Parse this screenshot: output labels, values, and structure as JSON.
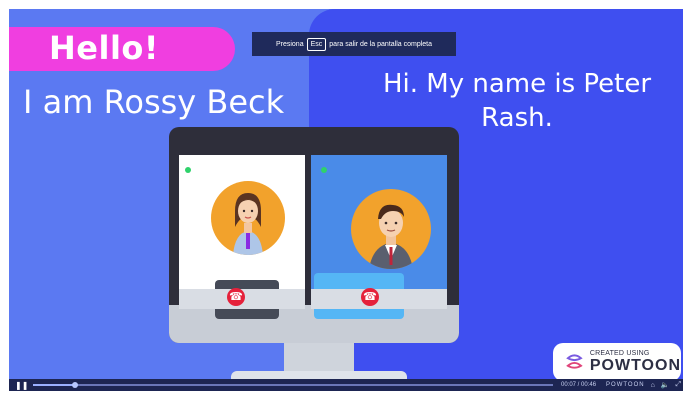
{
  "overlay": {
    "esc_hint_before": "Presiona",
    "esc_key": "Esc",
    "esc_hint_after": "para salir de la pantalla completa"
  },
  "slide": {
    "hello": "Hello!",
    "left_intro": "I am Rossy Beck",
    "right_intro_line1": "Hi. My name is Peter",
    "right_intro_line2": "Rash."
  },
  "watermark": {
    "created_using": "CREATED USING",
    "brand": "POWTOON"
  },
  "player": {
    "play_state_icon": "pause-icon",
    "time": "00:07 / 00:46",
    "brand": "POWTOON",
    "progress": 0.08
  },
  "colors": {
    "accent_pink": "#f03ee0",
    "bg_blue": "#5b79f2",
    "bg_dark_blue": "#3f4ff0",
    "end_call_red": "#e5213b"
  }
}
